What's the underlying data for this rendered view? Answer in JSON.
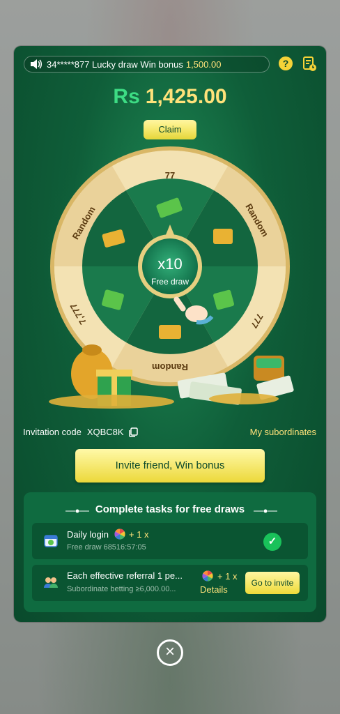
{
  "announcement": {
    "text": "34*****877 Lucky draw Win bonus",
    "amount": "1,500.00"
  },
  "header": {
    "help_icon": "?"
  },
  "balance": {
    "currency": "Rs",
    "amount": "1,425.00"
  },
  "claim_label": "Claim",
  "wheel": {
    "segments": [
      "77",
      "Random",
      "777",
      "Random",
      "7,777",
      "Random"
    ],
    "center_multiplier": "x10",
    "center_label": "Free draw"
  },
  "invitation": {
    "label": "Invitation code",
    "code": "XQBC8K"
  },
  "subordinates_label": "My subordinates",
  "invite_button": "Invite friend, Win bonus",
  "tasks": {
    "title": "Complete tasks for free draws",
    "items": [
      {
        "title": "Daily login",
        "reward": "+ 1 x",
        "subtitle": "Free draw  68516:57:05",
        "status": "completed"
      },
      {
        "title": "Each effective referral 1 pe...",
        "reward": "+ 1 x",
        "subtitle": "Subordinate betting ≥6,000.00...",
        "details": "Details",
        "action": "Go to invite"
      }
    ]
  },
  "close_icon": "×",
  "colors": {
    "panel": "#0f5e39",
    "accent_yellow": "#ffe27a",
    "green_currency": "#3ddc84",
    "button_yellow": "#eedb3a"
  }
}
